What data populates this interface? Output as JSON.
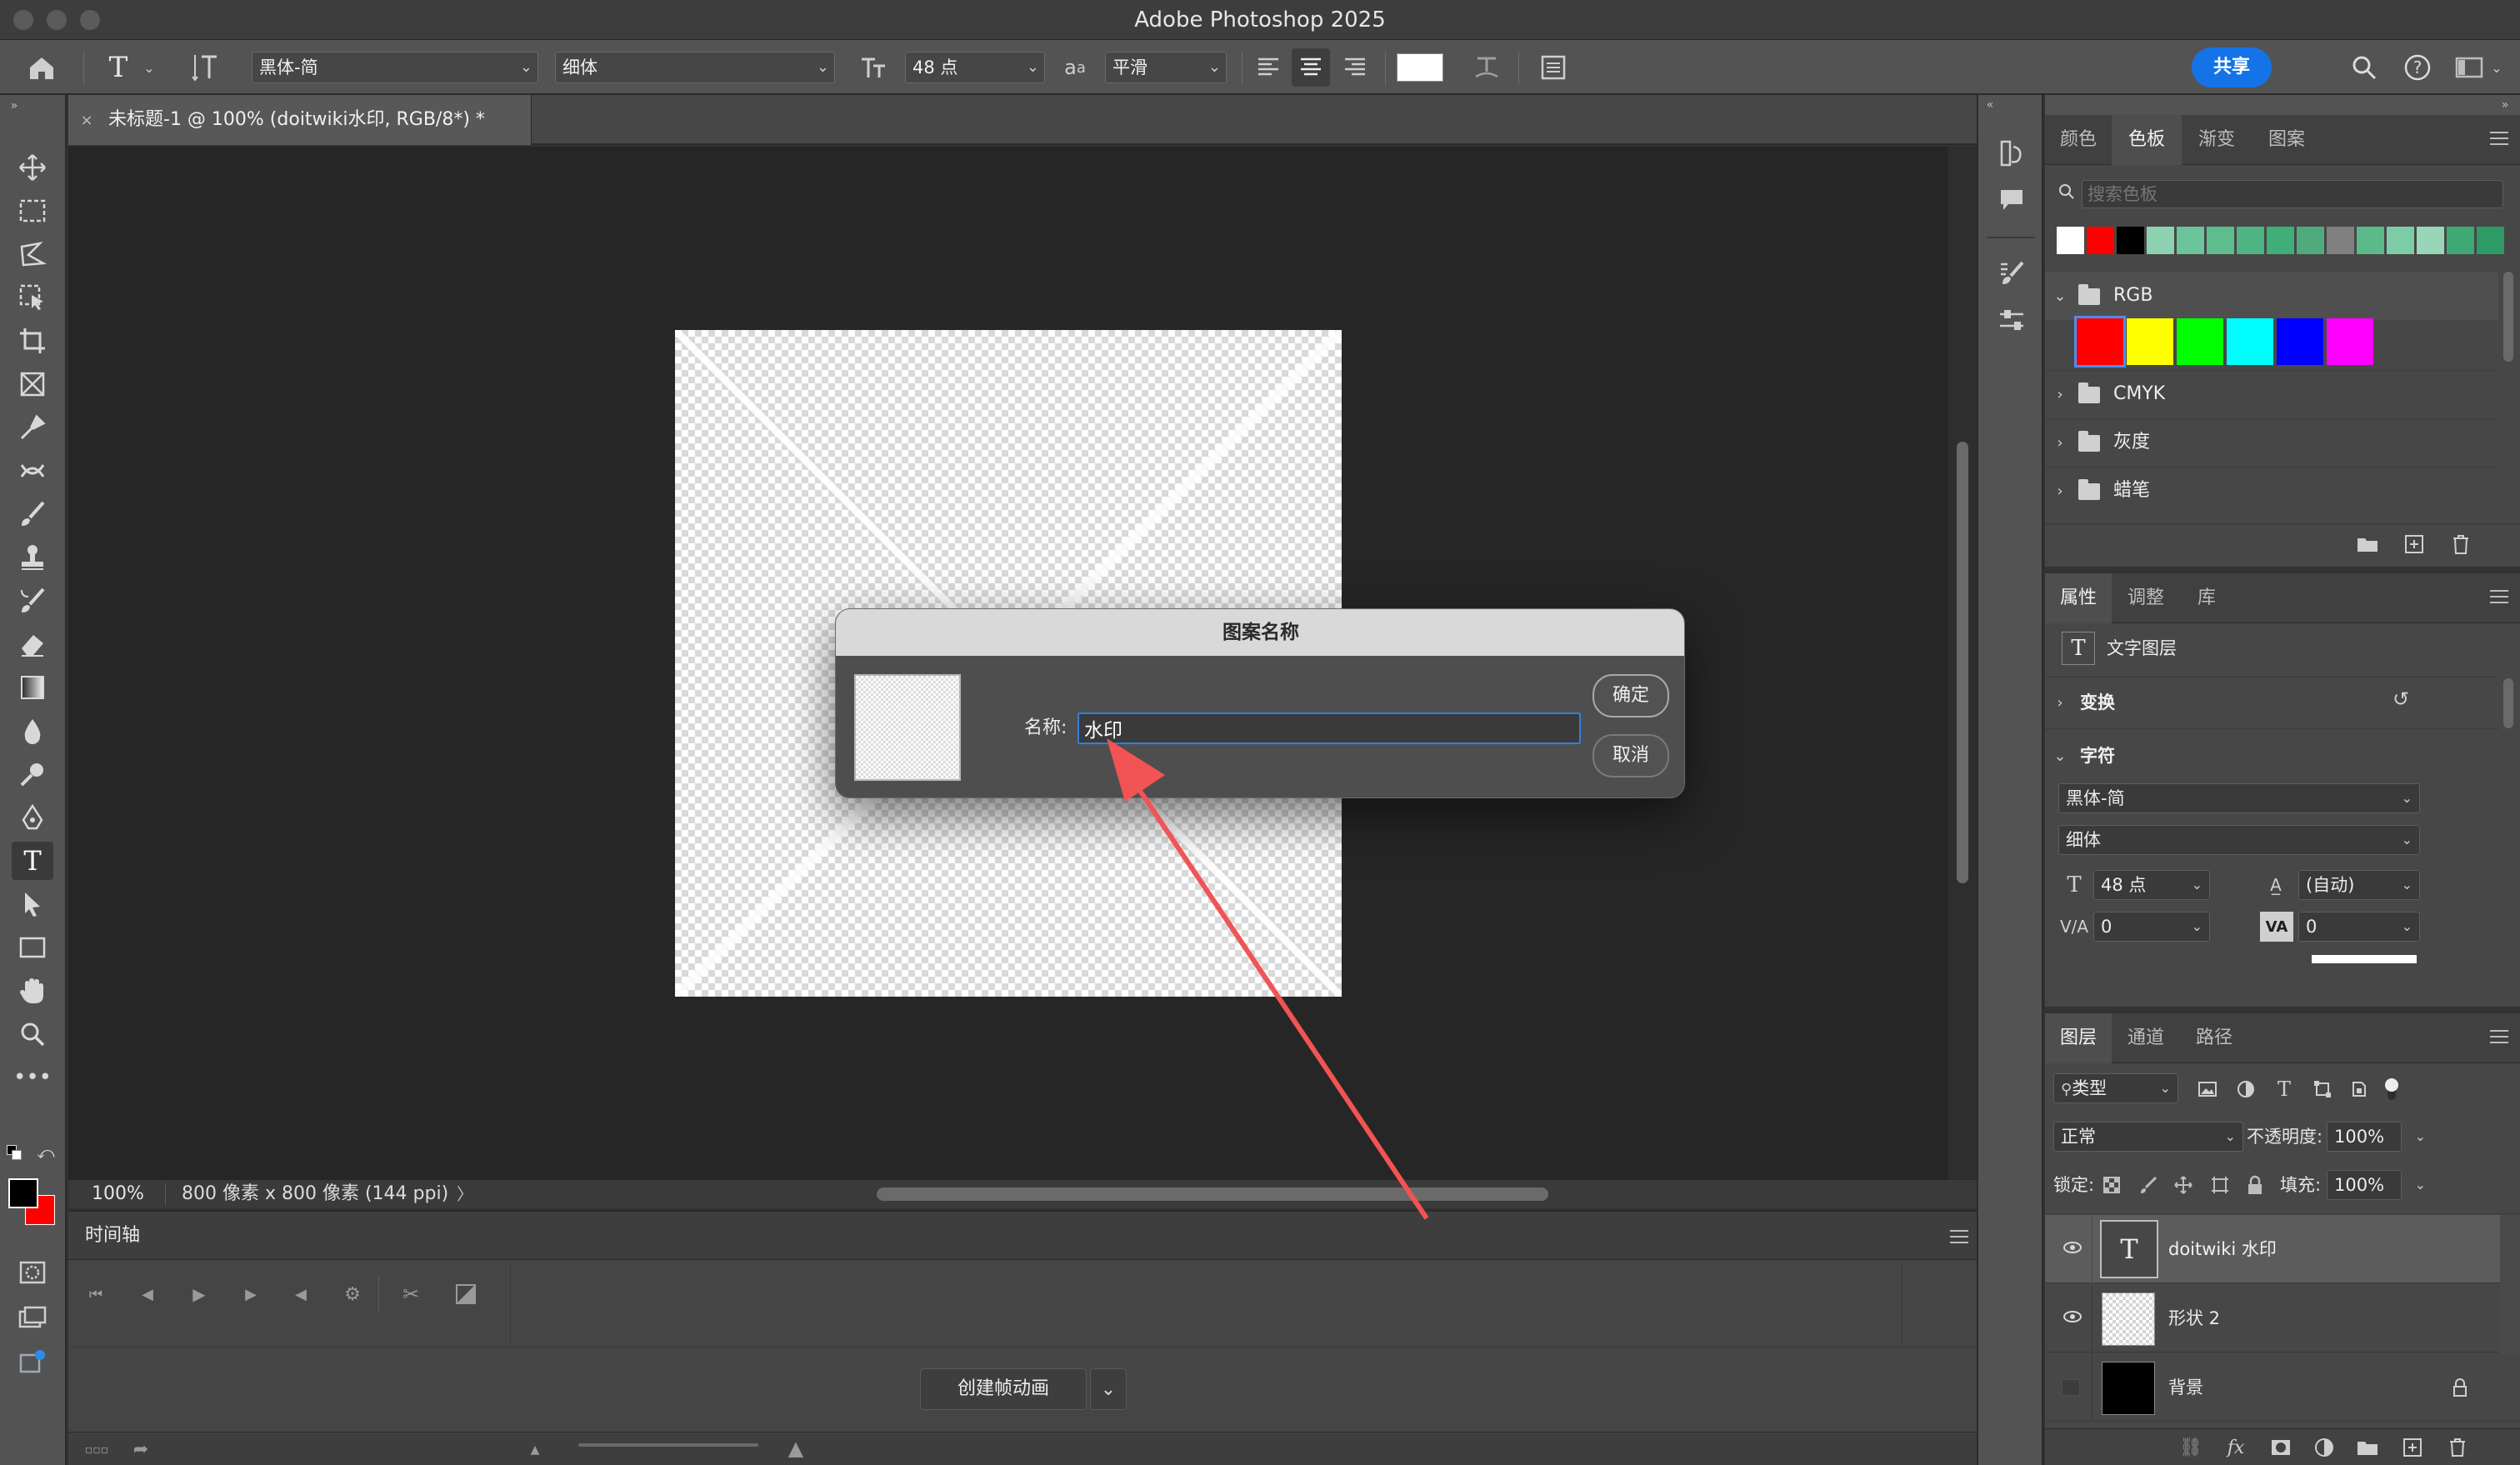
{
  "window": {
    "title": "Adobe Photoshop 2025"
  },
  "options_bar": {
    "font_family": "黑体-简",
    "font_style": "细体",
    "font_size": "48 点",
    "aa_icon_label": "a",
    "aa_icon_label_big": "a",
    "anti_alias": "平滑",
    "share_label": "共享",
    "color_swatch": "#ffffff"
  },
  "document": {
    "tab_label": "未标题-1 @ 100% (doitwiki水印, RGB/8*) *",
    "zoom": "100%",
    "info": "800 像素 x 800 像素 (144 ppi)",
    "info_arrow": "〉"
  },
  "dialog": {
    "title": "图案名称",
    "name_label": "名称:",
    "name_value": "水印",
    "ok_label": "确定",
    "cancel_label": "取消"
  },
  "timeline": {
    "title": "时间轴",
    "create_label": "创建帧动画"
  },
  "swatches_panel": {
    "tabs": [
      "颜色",
      "色板",
      "渐变",
      "图案"
    ],
    "active_tab": 1,
    "search_placeholder": "搜索色板",
    "recent_colors": [
      "#ffffff",
      "#ff0000",
      "#000000",
      "#8ed1b1",
      "#6cc49a",
      "#5dbd8e",
      "#4fb483",
      "#3fae79",
      "#4faa7e",
      "#808080",
      "#5aba8a",
      "#7ccda5",
      "#99d6b7",
      "#3fa874",
      "#2e9b66"
    ],
    "groups": [
      {
        "name": "RGB",
        "expanded": true,
        "colors": [
          "#ff0000",
          "#ffff00",
          "#00ff00",
          "#00ffff",
          "#0000ff",
          "#ff00ff"
        ]
      },
      {
        "name": "CMYK",
        "expanded": false
      },
      {
        "name": "灰度",
        "expanded": false
      },
      {
        "name": "蜡笔",
        "expanded": false
      }
    ]
  },
  "properties_panel": {
    "tabs": [
      "属性",
      "调整",
      "库"
    ],
    "active_tab": 0,
    "layer_type": "文字图层",
    "transform_label": "变换",
    "character_label": "字符",
    "font_family": "黑体-简",
    "font_style": "细体",
    "font_size": "48 点",
    "leading": "(自动)",
    "kerning": "0",
    "tracking": "0"
  },
  "layers_panel": {
    "tabs": [
      "图层",
      "通道",
      "路径"
    ],
    "active_tab": 0,
    "filter_label": "类型",
    "blend_mode": "正常",
    "opacity_label": "不透明度:",
    "opacity_value": "100%",
    "lock_label": "锁定:",
    "fill_label": "填充:",
    "fill_value": "100%",
    "layers": [
      {
        "name": "doitwiki 水印",
        "type": "text",
        "visible": true,
        "selected": true
      },
      {
        "name": "形状 2",
        "type": "shape",
        "visible": true,
        "selected": false
      },
      {
        "name": "背景",
        "type": "background",
        "visible": false,
        "locked": true
      }
    ]
  }
}
